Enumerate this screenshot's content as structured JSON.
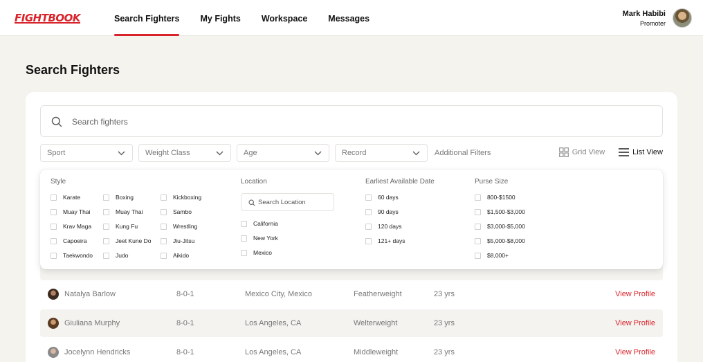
{
  "app": {
    "logo": "FIGHTBOOK"
  },
  "nav": {
    "items": [
      "Search Fighters",
      "My Fights",
      "Workspace",
      "Messages"
    ],
    "active_index": 0
  },
  "user": {
    "name": "Mark Habibi",
    "role": "Promoter"
  },
  "page": {
    "title": "Search Fighters"
  },
  "search": {
    "placeholder": "Search fighters",
    "value": ""
  },
  "filters": {
    "dropdowns": [
      "Sport",
      "Weight Class",
      "Age",
      "Record"
    ],
    "additional": "Additional Filters"
  },
  "views": {
    "grid": "Grid View",
    "list": "List View",
    "selected": "list"
  },
  "panel": {
    "style_heading": "Style",
    "styles": [
      "Karate",
      "Boxing",
      "Kickboxing",
      "Muay Thai",
      "Muay Thai",
      "Sambo",
      "Krav Maga",
      "Kung Fu",
      "Wrestling",
      "Capoeira",
      "Jeet Kune Do",
      "Jiu-Jitsu",
      "Taekwondo",
      "Judo",
      "Aikido"
    ],
    "location_heading": "Location",
    "location_placeholder": "Search Location",
    "locations": [
      "California",
      "New York",
      "Mexico"
    ],
    "date_heading": "Earliest Available Date",
    "dates": [
      "60 days",
      "90 days",
      "120 days",
      "121+ days"
    ],
    "purse_heading": "Purse Size",
    "purses": [
      "800-$1500",
      "$1,500-$3,000",
      "$3,000-$5,000",
      "$5,000-$8,000",
      "$8,000+"
    ]
  },
  "table": {
    "rows": [
      {
        "name": "Natalya Barlow",
        "record": "8-0-1",
        "location": "Mexico City, Mexico",
        "weight": "Featherweight",
        "age": "23 yrs",
        "action": "View Profile"
      },
      {
        "name": "Giuliana Murphy",
        "record": "8-0-1",
        "location": "Los Angeles, CA",
        "weight": "Welterweight",
        "age": "23 yrs",
        "action": "View Profile"
      },
      {
        "name": "Jocelynn Hendricks",
        "record": "8-0-1",
        "location": "Los Angeles, CA",
        "weight": "Middleweight",
        "age": "23 yrs",
        "action": "View Profile"
      }
    ]
  },
  "colors": {
    "accent": "#d8232a",
    "background": "#f5f3ee",
    "row_alt": "#f4f3f0"
  }
}
